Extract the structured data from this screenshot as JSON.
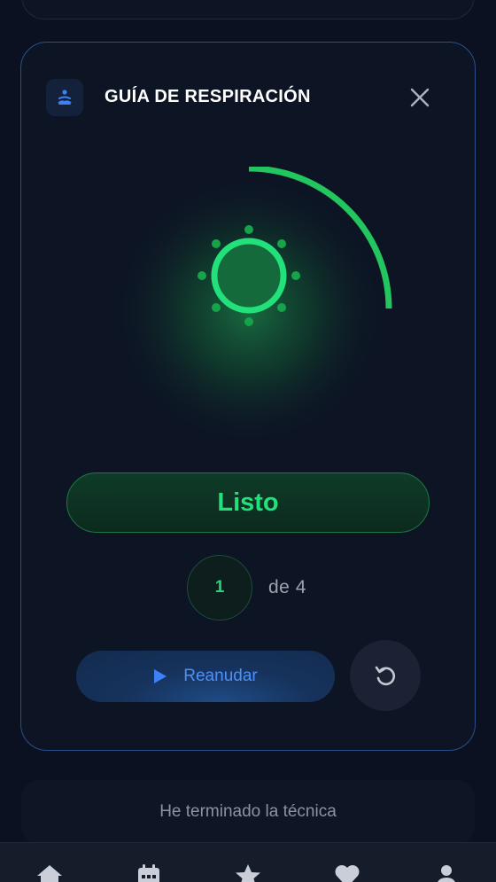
{
  "breathing_card": {
    "title": "GUÍA DE RESPIRACIÓN",
    "header_icon": "meditation-icon",
    "close_icon": "close-icon",
    "progress_fraction": 0.25,
    "status": "Listo",
    "cycle": {
      "current": "1",
      "total_text": "de 4"
    },
    "resume_label": "Reanudar",
    "play_icon": "play-icon",
    "reset_icon": "reset-icon"
  },
  "done_button": {
    "label": "He terminado la técnica"
  },
  "bottom_nav": {
    "items": [
      {
        "icon": "home-icon"
      },
      {
        "icon": "calendar-icon"
      },
      {
        "icon": "star-icon"
      },
      {
        "icon": "heart-icon"
      },
      {
        "icon": "profile-icon"
      }
    ]
  },
  "colors": {
    "background": "#0b1120",
    "card_border": "#2a4f8a",
    "accent_green": "#22e07a",
    "accent_blue": "#4f8ff7"
  }
}
